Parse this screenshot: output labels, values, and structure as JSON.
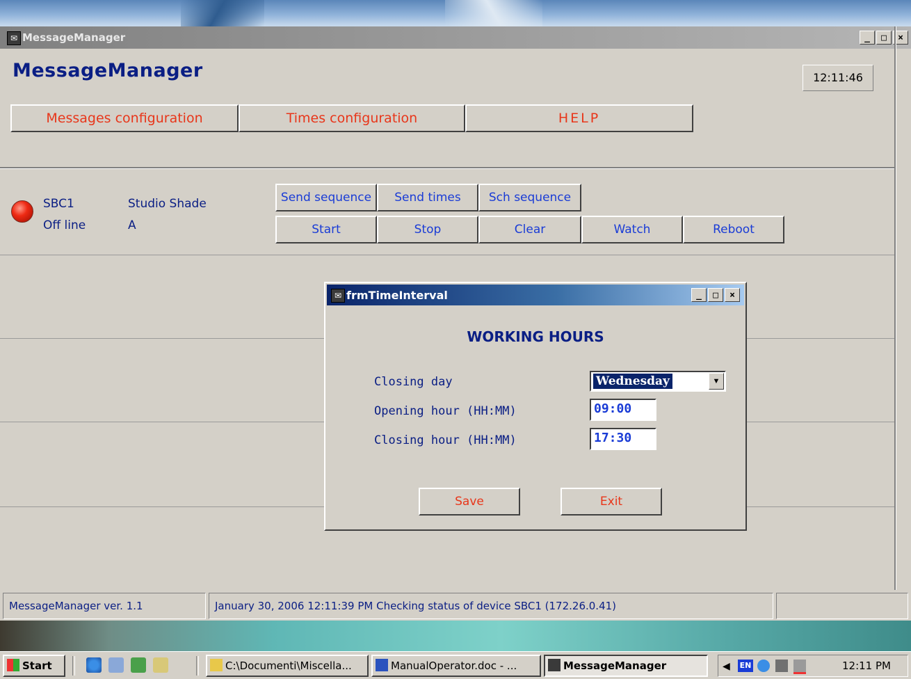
{
  "window": {
    "title": "MessageManager"
  },
  "app": {
    "title": "MessageManager",
    "clock": "12:11:46"
  },
  "nav": [
    {
      "label": "Messages configuration"
    },
    {
      "label": "Times configuration"
    },
    {
      "label": "HELP"
    }
  ],
  "device": {
    "name": "SBC1",
    "status": "Off line",
    "location": "Studio Shade",
    "group": "A"
  },
  "controls": {
    "send_sequence": "Send sequence",
    "send_times": "Send times",
    "sch_sequence": "Sch sequence",
    "start": "Start",
    "stop": "Stop",
    "clear": "Clear",
    "watch": "Watch",
    "reboot": "Reboot"
  },
  "dialog": {
    "title": "frmTimeInterval",
    "heading": "WORKING HOURS",
    "closing_day_label": "Closing day",
    "closing_day_value": "Wednesday",
    "opening_hour_label": "Opening hour (HH:MM)",
    "opening_hour_value": "09:00",
    "closing_hour_label": "Closing hour (HH:MM)",
    "closing_hour_value": "17:30",
    "save": "Save",
    "exit": "Exit"
  },
  "status": {
    "version": "MessageManager ver. 1.1",
    "message": "January 30, 2006 12:11:39 PM Checking status of device SBC1 (172.26.0.41)"
  },
  "taskbar": {
    "start": "Start",
    "tasks": [
      "C:\\Documenti\\Miscella...",
      "ManualOperator.doc - ...",
      "MessageManager"
    ],
    "lang": "EN",
    "time": "12:11 PM"
  },
  "colors": {
    "title_blue": "#0a1e84",
    "button_red": "#e8361a",
    "button_blue": "#1a3cd6",
    "led_red": "#ee2a14"
  }
}
